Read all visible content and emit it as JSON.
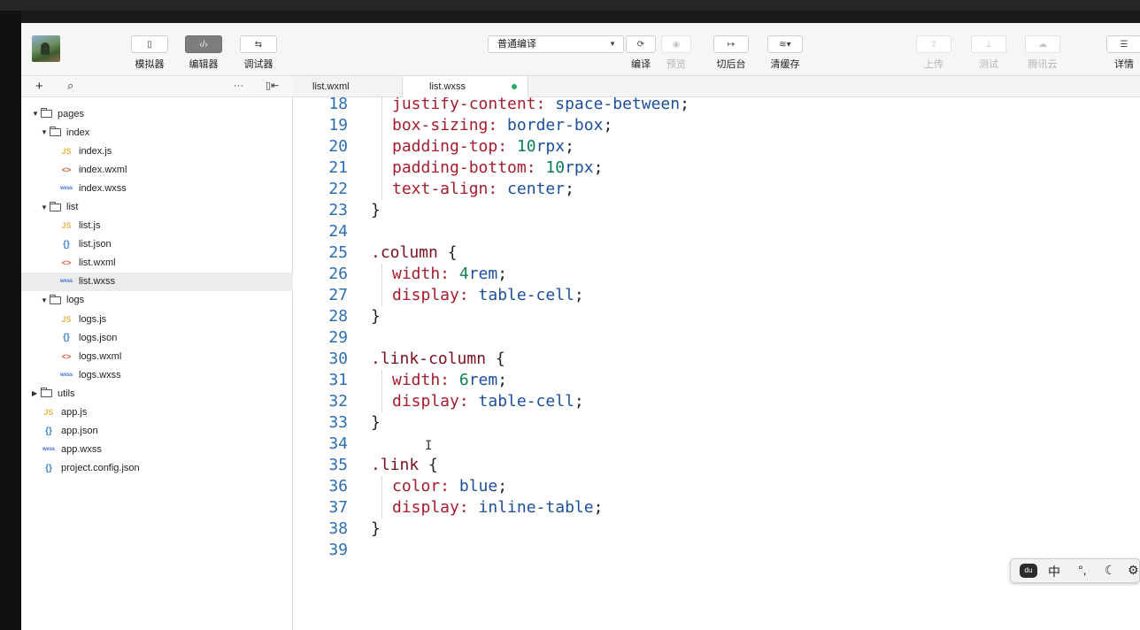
{
  "toolbar": {
    "simulator": "模拟器",
    "editor": "编辑器",
    "debugger": "调试器",
    "compile_mode": "普通编译",
    "compile": "编译",
    "preview": "预览",
    "background": "切后台",
    "clear_cache": "清缓存",
    "upload": "上传",
    "test": "测试",
    "cloud": "腾讯云",
    "details": "详情"
  },
  "sidebar": {
    "more": "···",
    "tree": [
      {
        "label": "pages"
      },
      {
        "label": "index"
      },
      {
        "label": "index.js",
        "badge": "JS"
      },
      {
        "label": "index.wxml",
        "badge": "<>"
      },
      {
        "label": "index.wxss",
        "badge": "wxss"
      },
      {
        "label": "list"
      },
      {
        "label": "list.js",
        "badge": "JS"
      },
      {
        "label": "list.json",
        "badge": "{}"
      },
      {
        "label": "list.wxml",
        "badge": "<>"
      },
      {
        "label": "list.wxss",
        "badge": "wxss"
      },
      {
        "label": "logs"
      },
      {
        "label": "logs.js",
        "badge": "JS"
      },
      {
        "label": "logs.json",
        "badge": "{}"
      },
      {
        "label": "logs.wxml",
        "badge": "<>"
      },
      {
        "label": "logs.wxss",
        "badge": "wxss"
      },
      {
        "label": "utils"
      },
      {
        "label": "app.js",
        "badge": "JS"
      },
      {
        "label": "app.json",
        "badge": "{}"
      },
      {
        "label": "app.wxss",
        "badge": "wxss"
      },
      {
        "label": "project.config.json",
        "badge": "{}"
      }
    ]
  },
  "tabs": [
    {
      "label": "list.wxml"
    },
    {
      "label": "list.wxss"
    }
  ],
  "code": [
    {
      "n": "18",
      "prop": "justify-content:",
      "val": " space-between",
      "tail": ";"
    },
    {
      "n": "19",
      "prop": "box-sizing:",
      "val": " border-box",
      "tail": ";"
    },
    {
      "n": "20",
      "prop": "padding-top:",
      "num": " 10",
      "val": "rpx",
      "tail": ";"
    },
    {
      "n": "21",
      "prop": "padding-bottom:",
      "num": " 10",
      "val": "rpx",
      "tail": ";"
    },
    {
      "n": "22",
      "prop": "text-align:",
      "val": " center",
      "tail": ";"
    },
    {
      "n": "23",
      "text": "}"
    },
    {
      "n": "24",
      "text": ""
    },
    {
      "n": "25",
      "sel": ".column",
      "text": " {"
    },
    {
      "n": "26",
      "prop": "width:",
      "num": " 4",
      "val": "rem",
      "tail": ";"
    },
    {
      "n": "27",
      "prop": "display:",
      "val": " table-cell",
      "tail": ";"
    },
    {
      "n": "28",
      "text": "}"
    },
    {
      "n": "29",
      "text": ""
    },
    {
      "n": "30",
      "sel": ".link-column",
      "text": " {"
    },
    {
      "n": "31",
      "prop": "width:",
      "num": " 6",
      "val": "rem",
      "tail": ";"
    },
    {
      "n": "32",
      "prop": "display:",
      "val": " table-cell",
      "tail": ";"
    },
    {
      "n": "33",
      "text": "}"
    },
    {
      "n": "34",
      "text": ""
    },
    {
      "n": "35",
      "sel": ".link",
      "text": " {"
    },
    {
      "n": "36",
      "prop": "color:",
      "val": " blue",
      "tail": ";"
    },
    {
      "n": "37",
      "prop": "display:",
      "val": " inline-table",
      "tail": ";"
    },
    {
      "n": "38",
      "text": "}"
    },
    {
      "n": "39",
      "text": ""
    }
  ],
  "ime": {
    "lang": "中",
    "punct": "°,"
  },
  "colors": {
    "property": "#a51d2d",
    "value": "#1c4f9c",
    "number": "#0b7d4e",
    "line_number": "#2c6fb0",
    "modified_dot": "#2aa865"
  }
}
